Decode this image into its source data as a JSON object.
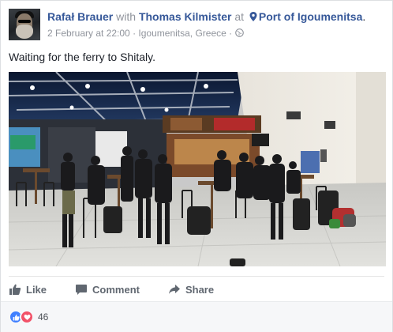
{
  "post": {
    "author": "Rafał Brauer",
    "with_word": "with",
    "tagged": "Thomas Kilmister",
    "at_word": "at",
    "place": "Port of Igoumenitsa",
    "timestamp": "2 February at 22:00",
    "location": "Igoumenitsa, Greece",
    "separator": "·",
    "body": "Waiting for the ferry to Shitaly.",
    "privacy_icon": "globe-icon"
  },
  "actions": {
    "like": "Like",
    "comment": "Comment",
    "share": "Share"
  },
  "reactions": {
    "count": "46",
    "types": [
      "like-icon",
      "love-icon"
    ]
  },
  "colors": {
    "link": "#365899",
    "muted": "#90949c",
    "like_blue": "#4080ff",
    "love_red": "#f25268"
  }
}
